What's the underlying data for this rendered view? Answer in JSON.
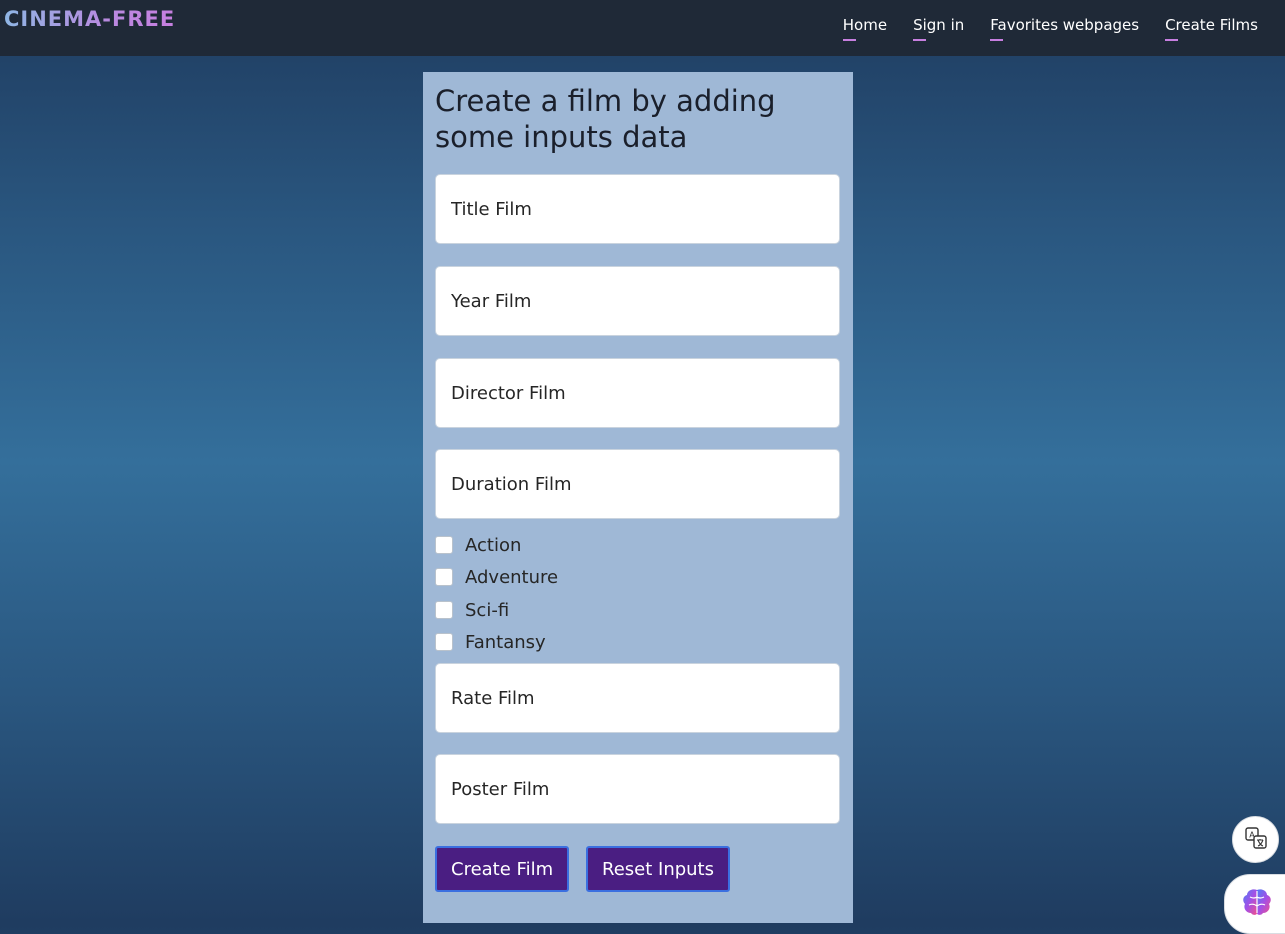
{
  "navbar": {
    "brand": "CINEMA-FREE",
    "links": [
      {
        "label": "Home"
      },
      {
        "label": "Sign in"
      },
      {
        "label": "Favorites webpages"
      },
      {
        "label": "Create Films"
      }
    ]
  },
  "form": {
    "title": "Create a film by adding some inputs data",
    "fields": {
      "title": {
        "placeholder": "Title Film",
        "value": ""
      },
      "year": {
        "placeholder": "Year Film",
        "value": ""
      },
      "director": {
        "placeholder": "Director Film",
        "value": ""
      },
      "duration": {
        "placeholder": "Duration Film",
        "value": ""
      },
      "rate": {
        "placeholder": "Rate Film",
        "value": ""
      },
      "poster": {
        "placeholder": "Poster Film",
        "value": ""
      }
    },
    "genres": [
      {
        "label": "Action",
        "checked": false
      },
      {
        "label": "Adventure",
        "checked": false
      },
      {
        "label": "Sci-fi",
        "checked": false
      },
      {
        "label": "Fantansy",
        "checked": false
      }
    ],
    "buttons": {
      "create": "Create Film",
      "reset": "Reset Inputs"
    }
  },
  "floating": {
    "translate_icon": "translate-icon",
    "brain_icon": "brain-icon"
  },
  "colors": {
    "navbar_bg": "#1f2937",
    "panel_bg": "#9fb8d6",
    "button_bg": "#4a1e82",
    "button_border": "#3b6fe0",
    "accent": "#c77fe0"
  }
}
